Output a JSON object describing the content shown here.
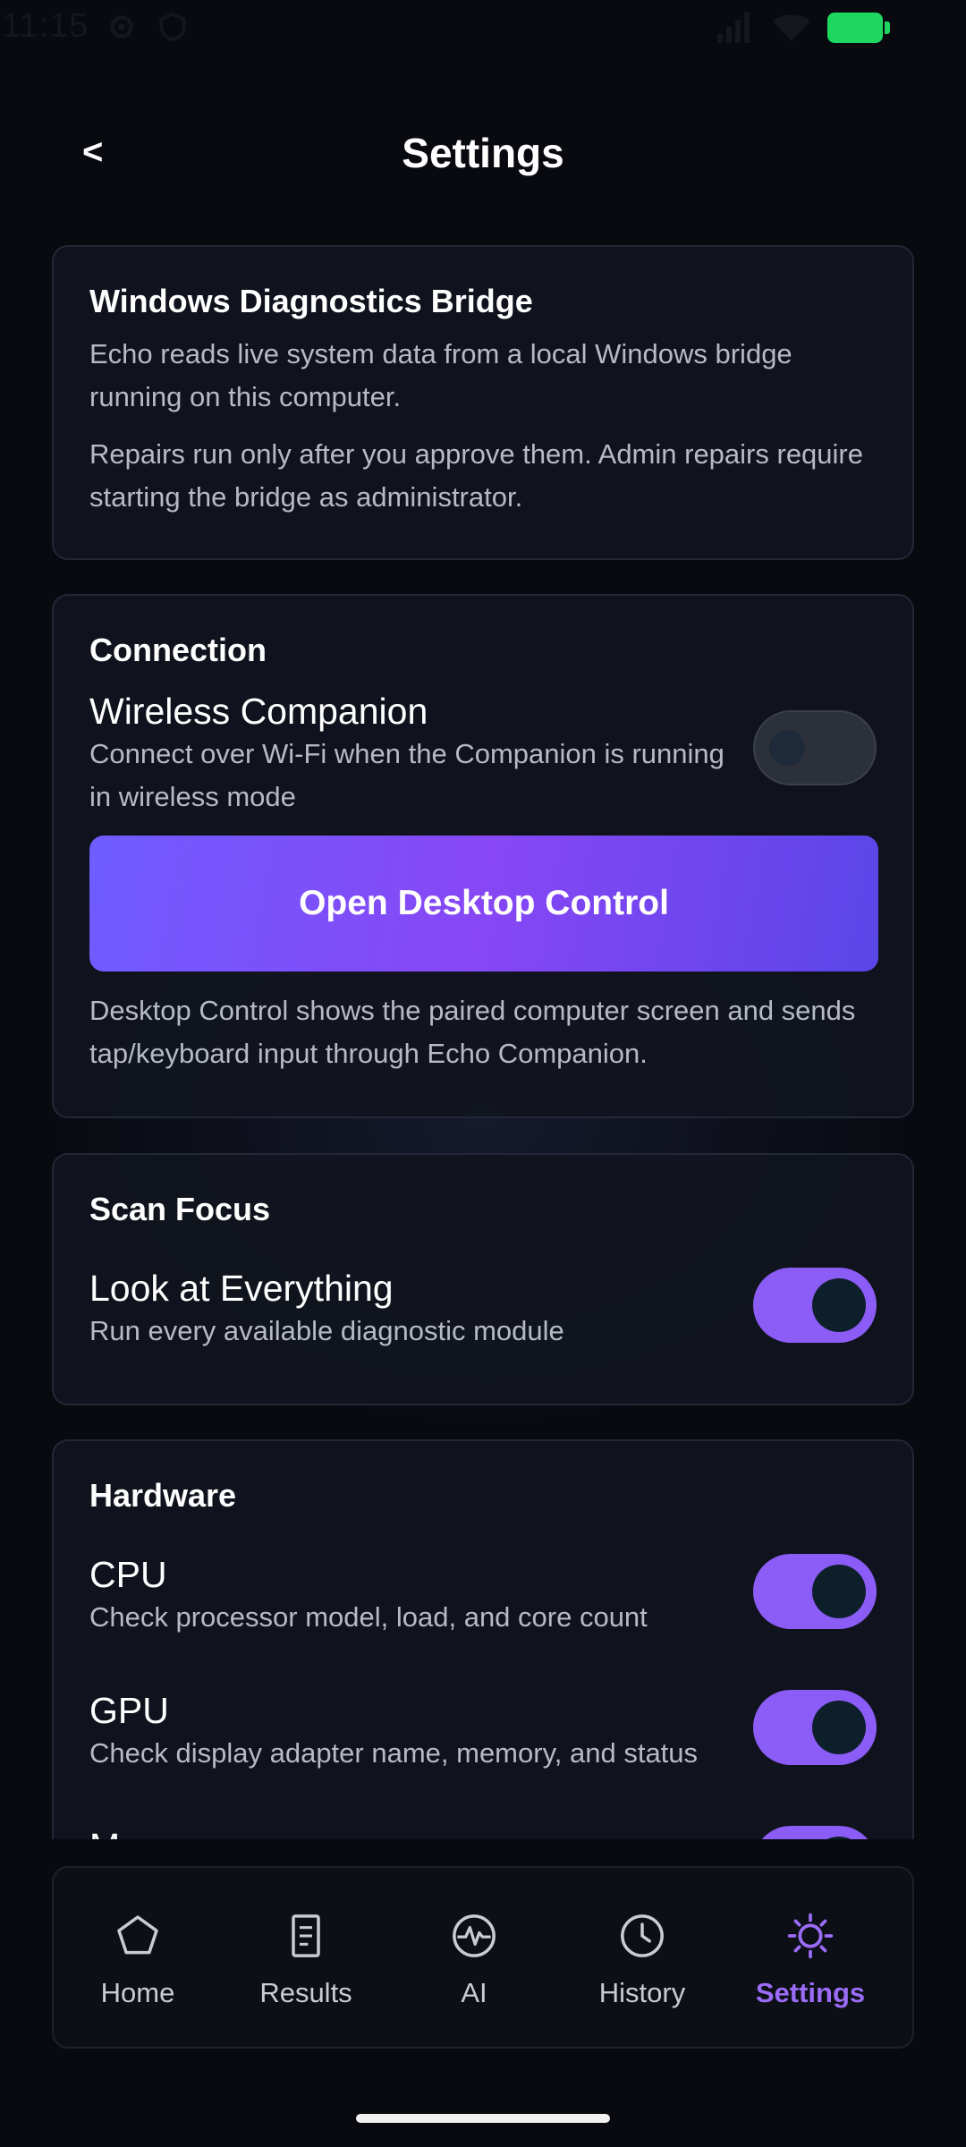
{
  "status_bar": {
    "time": "11:15",
    "icons": [
      "gear-icon",
      "shield-icon",
      "signal-icon",
      "wifi-icon",
      "battery-icon"
    ],
    "battery_color": "#1ed760"
  },
  "header": {
    "back_label": "<",
    "title": "Settings"
  },
  "bridge_card": {
    "title": "Windows Diagnostics Bridge",
    "paragraph1": "Echo reads live system data from a local Windows bridge running on this computer.",
    "paragraph2": "Repairs run only after you approve them. Admin repairs require starting the bridge as administrator."
  },
  "connection_card": {
    "title": "Connection",
    "wireless": {
      "title": "Wireless Companion",
      "description": "Connect over Wi-Fi when the Companion is running in wireless mode",
      "enabled": false
    },
    "desktop_button": "Open Desktop Control",
    "footer": "Desktop Control shows the paired computer screen and sends tap/keyboard input through Echo Companion."
  },
  "scan_focus_card": {
    "title": "Scan Focus",
    "everything": {
      "title": "Look at Everything",
      "description": "Run every available diagnostic module",
      "enabled": true
    }
  },
  "hardware_card": {
    "title": "Hardware",
    "items": [
      {
        "title": "CPU",
        "description": "Check processor model, load, and core count",
        "enabled": true
      },
      {
        "title": "GPU",
        "description": "Check display adapter name, memory, and status",
        "enabled": true
      },
      {
        "title": "M",
        "description": "",
        "enabled": true
      }
    ]
  },
  "bottom_nav": {
    "items": [
      {
        "label": "Home",
        "icon": "pentagon-home-icon",
        "active": false
      },
      {
        "label": "Results",
        "icon": "document-icon",
        "active": false
      },
      {
        "label": "AI",
        "icon": "pulse-icon",
        "active": false
      },
      {
        "label": "History",
        "icon": "clock-icon",
        "active": false
      },
      {
        "label": "Settings",
        "icon": "sun-gear-icon",
        "active": true
      }
    ]
  },
  "colors": {
    "accent": "#8b5cf6",
    "background": "#080a10",
    "card": "#11151e",
    "toggle_knob": "#0d1f2a",
    "muted_text": "#b6bac6"
  }
}
